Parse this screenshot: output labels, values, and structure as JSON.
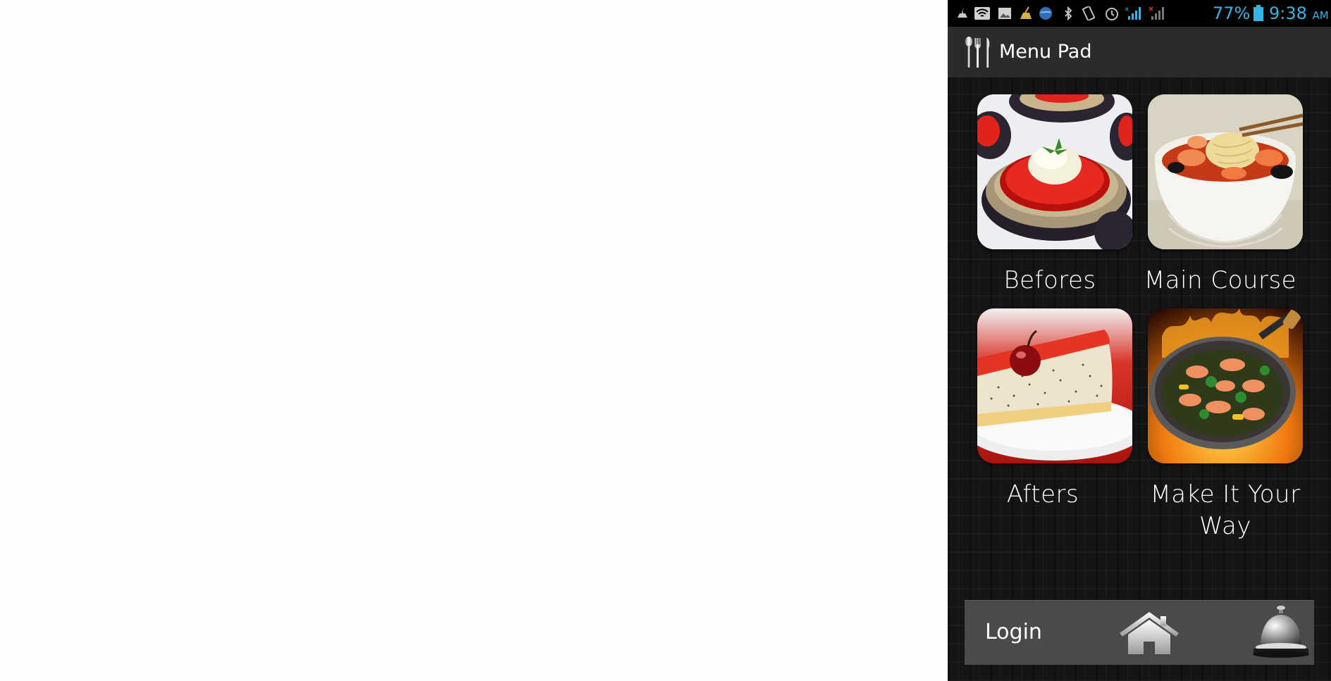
{
  "status_bar": {
    "battery": "77%",
    "time": "9:38",
    "ampm": "AM",
    "icons": [
      "usb-icon",
      "wifi-icon",
      "image-icon",
      "cleaner-icon",
      "globe-icon",
      "bluetooth-icon",
      "vibrate-icon",
      "alarm-icon",
      "signal-icon",
      "signal-no-sim-icon",
      "battery-icon"
    ],
    "accent_color": "#33b5e5"
  },
  "app_bar": {
    "title": "Menu Pad",
    "icon": "cutlery-icon"
  },
  "tiles": [
    {
      "label": "Befores",
      "image": "bruschetta-eggplant-photo"
    },
    {
      "label": "Main Course",
      "image": "seafood-noodle-soup-photo"
    },
    {
      "label": "Afters",
      "image": "cheesecake-photo"
    },
    {
      "label": "Make It Your Way",
      "label_line1": "Make It Your",
      "label_line2": "Way",
      "image": "shrimp-wok-photo"
    }
  ],
  "bottom_bar": {
    "login_label": "Login",
    "home_icon": "home-icon",
    "bell_icon": "service-bell-icon"
  }
}
